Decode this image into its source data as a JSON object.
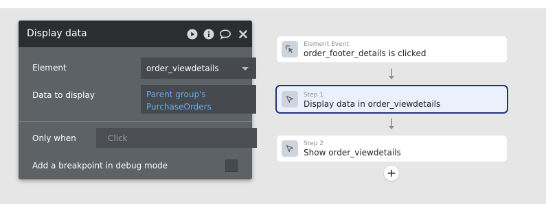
{
  "panel": {
    "title": "Display data",
    "header_icons": [
      "play-icon",
      "info-icon",
      "comment-icon",
      "close-icon"
    ],
    "element_label": "Element",
    "element_value": "order_viewdetails",
    "data_label": "Data to display",
    "data_line1": "Parent group's",
    "data_line2": "PurchaseOrders",
    "only_when_label": "Only when",
    "only_when_placeholder": "Click",
    "breakpoint_label": "Add a breakpoint in debug mode"
  },
  "workflow": {
    "event": {
      "kind": "Element Event",
      "text": "order_footer_details is clicked",
      "icon": "click-icon"
    },
    "steps": [
      {
        "kind": "Step 1",
        "text": "Display data in order_viewdetails",
        "icon": "cursor-icon",
        "selected": true
      },
      {
        "kind": "Step 2",
        "text": "Show order_viewdetails",
        "icon": "cursor-icon",
        "selected": false
      }
    ],
    "add_step": "+"
  },
  "colors": {
    "background": "#e6e6e6",
    "panel": "#5d6266",
    "panel_header": "#2a2e31",
    "link_blue": "#6aa9f0",
    "selected_border": "#203177",
    "selected_fill": "#eaf1fd"
  }
}
